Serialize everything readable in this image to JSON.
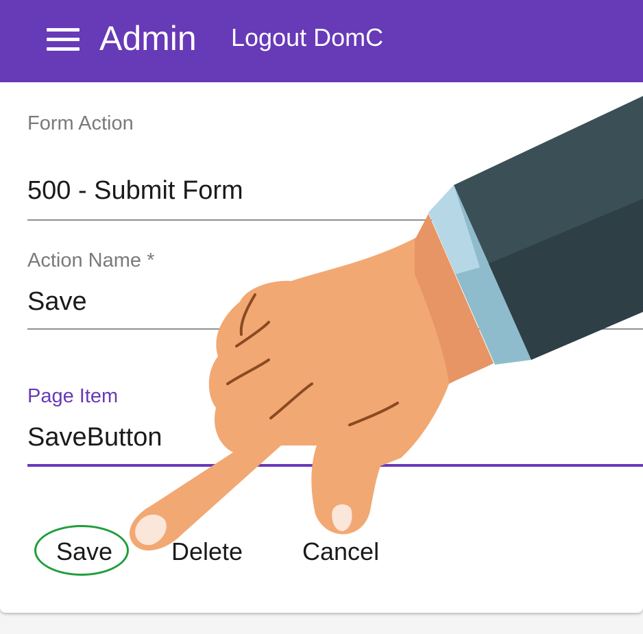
{
  "toolbar": {
    "title": "Admin",
    "logout_label": "Logout DomC",
    "menu_icon": "hamburger-menu-icon",
    "color": "#673ab7"
  },
  "form": {
    "fields": [
      {
        "label": "Form Action",
        "value": "500 - Submit Form"
      },
      {
        "label": "Action Name *",
        "value": "Save"
      },
      {
        "label": "Page Item",
        "value": "SaveButton"
      }
    ]
  },
  "actions": {
    "save_label": "Save",
    "delete_label": "Delete",
    "cancel_label": "Cancel"
  },
  "overlay": {
    "pointer_icon": "pointing-hand-icon",
    "highlight_color": "#1e9e3a"
  }
}
